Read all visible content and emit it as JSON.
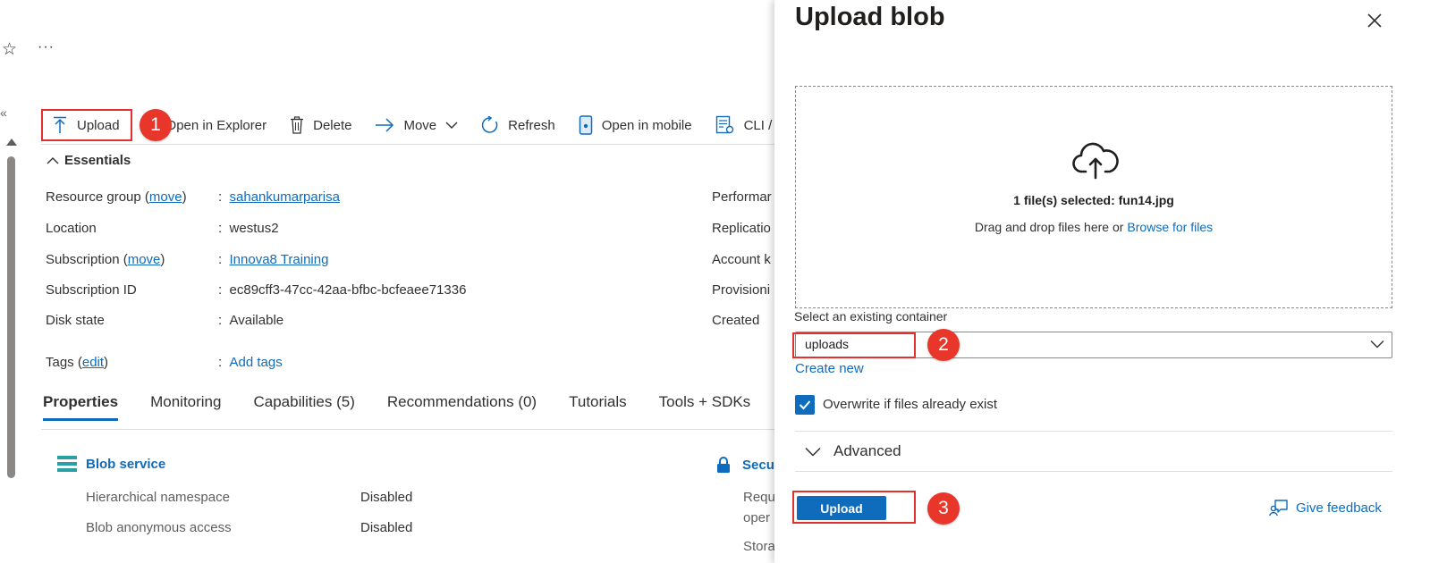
{
  "toolbar": {
    "upload": "Upload",
    "open_explorer": "Open in Explorer",
    "delete": "Delete",
    "move": "Move",
    "refresh": "Refresh",
    "open_mobile": "Open in mobile",
    "cli": "CLI /"
  },
  "essentials": {
    "header": "Essentials",
    "rg_label": "Resource group (",
    "rg_move": "move",
    "rg_close": ")",
    "rg_value": "sahankumarparisa",
    "loc_label": "Location",
    "loc_value": "westus2",
    "sub_label": "Subscription (",
    "sub_move": "move",
    "sub_close": ")",
    "sub_value": "Innova8 Training",
    "subid_label": "Subscription ID",
    "subid_value": "ec89cff3-47cc-42aa-bfbc-bcfeaee71336",
    "disk_label": "Disk state",
    "disk_value": "Available",
    "tags_label": "Tags (",
    "tags_edit": "edit",
    "tags_close": ")",
    "tags_value": "Add tags",
    "colon": ":",
    "right_labels": [
      "Performar",
      "Replicatio",
      "Account k",
      "Provisioni",
      "Created"
    ]
  },
  "tabs": [
    "Properties",
    "Monitoring",
    "Capabilities (5)",
    "Recommendations (0)",
    "Tutorials",
    "Tools + SDKs"
  ],
  "blob_service": {
    "title": "Blob service",
    "rows": [
      {
        "label": "Hierarchical namespace",
        "value": "Disabled"
      },
      {
        "label": "Blob anonymous access",
        "value": "Disabled"
      }
    ]
  },
  "security": {
    "title": "Secu",
    "lines": [
      "Requ",
      "oper",
      "Stora"
    ]
  },
  "panel": {
    "title": "Upload blob",
    "selected_files": "1 file(s) selected: fun14.jpg",
    "drag_text": "Drag and drop files here  or",
    "browse": "Browse for files",
    "container_label": "Select an existing container",
    "container_value": "uploads",
    "create_new": "Create new",
    "overwrite_label": "Overwrite if files already exist",
    "overwrite_checked": true,
    "advanced": "Advanced",
    "upload_button": "Upload",
    "feedback": "Give feedback"
  },
  "badges": [
    "1",
    "2",
    "3"
  ],
  "colors": {
    "accent": "#0f6cbd",
    "highlight": "#e3302f",
    "badge": "#e8362b"
  }
}
